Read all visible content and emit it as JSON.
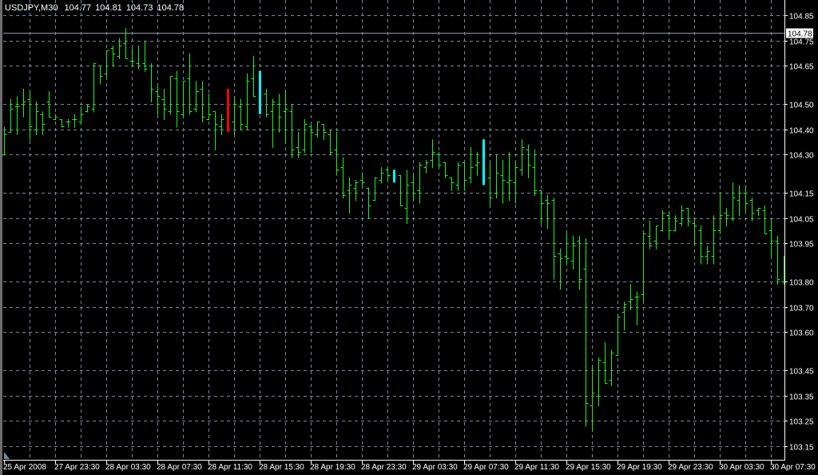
{
  "header": {
    "symbol": "USDJPY,M30",
    "open": "104.77",
    "high": "104.81",
    "low": "104.73",
    "close": "104.78"
  },
  "colors": {
    "background": "#000000",
    "bar": "#22ee22",
    "grid": "#778899",
    "axis": "#ffffff",
    "highlight_red": "#ff0000",
    "highlight_cyan": "#00ffff"
  },
  "chart_data": {
    "type": "ohlc",
    "title": "USDJPY,M30",
    "timeframe_minutes": 30,
    "ylim": [
      103.15,
      104.85
    ],
    "current_price": 104.78,
    "current_price_label": "104.78",
    "grid": true,
    "y_ticks": [
      "104.85",
      "104.75",
      "104.65",
      "104.50",
      "104.40",
      "104.30",
      "104.15",
      "104.05",
      "103.95",
      "103.80",
      "103.70",
      "103.60",
      "103.45",
      "103.35",
      "103.25",
      "103.15"
    ],
    "x_ticks": [
      {
        "bar": 0,
        "label": "25 Apr 2008"
      },
      {
        "bar": 8,
        "label": "27 Apr 23:30"
      },
      {
        "bar": 16,
        "label": "28 Apr 03:30"
      },
      {
        "bar": 24,
        "label": "28 Apr 07:30"
      },
      {
        "bar": 32,
        "label": "28 Apr 11:30"
      },
      {
        "bar": 40,
        "label": "28 Apr 15:30"
      },
      {
        "bar": 48,
        "label": "28 Apr 19:30"
      },
      {
        "bar": 56,
        "label": "28 Apr 23:30"
      },
      {
        "bar": 64,
        "label": "29 Apr 03:30"
      },
      {
        "bar": 72,
        "label": "29 Apr 07:30"
      },
      {
        "bar": 80,
        "label": "29 Apr 11:30"
      },
      {
        "bar": 88,
        "label": "29 Apr 15:30"
      },
      {
        "bar": 96,
        "label": "29 Apr 19:30"
      },
      {
        "bar": 104,
        "label": "29 Apr 23:30"
      },
      {
        "bar": 112,
        "label": "30 Apr 03:30"
      },
      {
        "bar": 120,
        "label": "30 Apr 07:30"
      }
    ],
    "highlights": [
      {
        "bar": 35,
        "color": "red"
      },
      {
        "bar": 40,
        "color": "cyan"
      },
      {
        "bar": 61,
        "color": "cyan"
      },
      {
        "bar": 75,
        "color": "cyan"
      }
    ],
    "ohlc": [
      [
        104.3,
        104.41,
        104.3,
        104.38
      ],
      [
        104.39,
        104.52,
        104.39,
        104.48
      ],
      [
        104.49,
        104.53,
        104.38,
        104.49
      ],
      [
        104.5,
        104.56,
        104.45,
        104.51
      ],
      [
        104.52,
        104.55,
        104.36,
        104.41
      ],
      [
        104.4,
        104.51,
        104.38,
        104.47
      ],
      [
        104.46,
        104.47,
        104.38,
        104.42
      ],
      [
        104.51,
        104.55,
        104.45,
        104.45
      ],
      [
        104.44,
        104.46,
        104.44,
        104.45
      ],
      [
        104.44,
        104.44,
        104.41,
        104.41
      ],
      [
        104.43,
        104.44,
        104.41,
        104.43
      ],
      [
        104.44,
        104.46,
        104.41,
        104.44
      ],
      [
        104.43,
        104.49,
        104.42,
        104.46
      ],
      [
        104.47,
        104.5,
        104.47,
        104.49
      ],
      [
        104.48,
        104.66,
        104.47,
        104.66
      ],
      [
        104.65,
        104.65,
        104.58,
        104.61
      ],
      [
        104.62,
        104.71,
        104.61,
        104.71
      ],
      [
        104.72,
        104.73,
        104.65,
        104.7
      ],
      [
        104.69,
        104.76,
        104.68,
        104.73
      ],
      [
        104.74,
        104.8,
        104.68,
        104.68
      ],
      [
        104.67,
        104.72,
        104.65,
        104.67
      ],
      [
        104.66,
        104.73,
        104.64,
        104.65
      ],
      [
        104.66,
        104.75,
        104.63,
        104.64
      ],
      [
        104.65,
        104.66,
        104.51,
        104.56
      ],
      [
        104.55,
        104.57,
        104.46,
        104.53
      ],
      [
        104.52,
        104.56,
        104.44,
        104.48
      ],
      [
        104.47,
        104.61,
        104.46,
        104.61
      ],
      [
        104.6,
        104.63,
        104.41,
        104.47
      ],
      [
        104.46,
        104.59,
        104.45,
        104.59
      ],
      [
        104.6,
        104.7,
        104.46,
        104.47
      ],
      [
        104.48,
        104.59,
        104.47,
        104.55
      ],
      [
        104.56,
        104.59,
        104.43,
        104.45
      ],
      [
        104.44,
        104.54,
        104.44,
        104.46
      ],
      [
        104.47,
        104.47,
        104.32,
        104.42
      ],
      [
        104.41,
        104.46,
        104.38,
        104.44
      ],
      [
        104.43,
        104.56,
        104.39,
        104.42
      ],
      [
        104.43,
        104.53,
        104.38,
        104.5
      ],
      [
        104.49,
        104.52,
        104.4,
        104.42
      ],
      [
        104.41,
        104.62,
        104.4,
        104.59
      ],
      [
        104.6,
        104.69,
        104.53,
        104.53
      ],
      [
        104.54,
        104.63,
        104.46,
        104.55
      ],
      [
        104.54,
        104.56,
        104.45,
        104.46
      ],
      [
        104.47,
        104.52,
        104.33,
        104.51
      ],
      [
        104.5,
        104.54,
        104.39,
        104.45
      ],
      [
        104.47,
        104.55,
        104.35,
        104.48
      ],
      [
        104.47,
        104.5,
        104.29,
        104.32
      ],
      [
        104.33,
        104.39,
        104.29,
        104.31
      ],
      [
        104.32,
        104.44,
        104.31,
        104.42
      ],
      [
        104.41,
        104.42,
        104.31,
        104.39
      ],
      [
        104.38,
        104.43,
        104.37,
        104.43
      ],
      [
        104.42,
        104.42,
        104.36,
        104.39
      ],
      [
        104.38,
        104.4,
        104.3,
        104.31
      ],
      [
        104.32,
        104.39,
        104.23,
        104.24
      ],
      [
        104.25,
        104.29,
        104.13,
        104.14
      ],
      [
        104.16,
        104.21,
        104.07,
        104.18
      ],
      [
        104.17,
        104.2,
        104.12,
        104.19
      ],
      [
        104.2,
        104.23,
        104.17,
        104.19
      ],
      [
        104.17,
        104.17,
        104.05,
        104.1
      ],
      [
        104.12,
        104.21,
        104.12,
        104.21
      ],
      [
        104.2,
        104.25,
        104.19,
        104.23
      ],
      [
        104.24,
        104.25,
        104.2,
        104.22
      ],
      [
        104.22,
        104.24,
        104.19,
        104.21
      ],
      [
        104.22,
        104.22,
        104.1,
        104.1
      ],
      [
        104.09,
        104.24,
        104.03,
        104.18
      ],
      [
        104.19,
        104.22,
        104.12,
        104.15
      ],
      [
        104.16,
        104.27,
        104.11,
        104.26
      ],
      [
        104.25,
        104.28,
        104.23,
        104.27
      ],
      [
        104.28,
        104.36,
        104.25,
        104.31
      ],
      [
        104.3,
        104.31,
        104.25,
        104.26
      ],
      [
        104.27,
        104.27,
        104.21,
        104.22
      ],
      [
        104.21,
        104.21,
        104.16,
        104.19
      ],
      [
        104.18,
        104.27,
        104.16,
        104.26
      ],
      [
        104.27,
        104.27,
        104.16,
        104.2
      ],
      [
        104.21,
        104.33,
        104.19,
        104.25
      ],
      [
        104.26,
        104.31,
        104.22,
        104.27
      ],
      [
        104.28,
        104.36,
        104.18,
        104.2
      ],
      [
        104.21,
        104.27,
        104.1,
        104.13
      ],
      [
        104.15,
        104.3,
        104.13,
        104.23
      ],
      [
        104.22,
        104.28,
        104.11,
        104.2
      ],
      [
        104.19,
        104.31,
        104.12,
        104.2
      ],
      [
        104.19,
        104.27,
        104.11,
        104.25
      ],
      [
        104.24,
        104.36,
        104.22,
        104.33
      ],
      [
        104.32,
        104.34,
        104.21,
        104.26
      ],
      [
        104.25,
        104.32,
        104.14,
        104.16
      ],
      [
        104.16,
        104.16,
        104.03,
        104.11
      ],
      [
        104.12,
        104.14,
        104.01,
        104.11
      ],
      [
        104.12,
        104.13,
        103.81,
        103.9
      ],
      [
        103.91,
        103.93,
        103.77,
        103.89
      ],
      [
        103.9,
        103.99,
        103.87,
        103.89
      ],
      [
        103.88,
        103.98,
        103.85,
        103.94
      ],
      [
        103.96,
        103.98,
        103.77,
        103.81
      ],
      [
        103.85,
        103.97,
        103.23,
        103.32
      ],
      [
        103.31,
        103.47,
        103.21,
        103.36
      ],
      [
        103.35,
        103.5,
        103.31,
        103.49
      ],
      [
        103.48,
        103.56,
        103.4,
        103.4
      ],
      [
        103.41,
        103.53,
        103.39,
        103.52
      ],
      [
        103.51,
        103.66,
        103.51,
        103.66
      ],
      [
        103.68,
        103.72,
        103.61,
        103.71
      ],
      [
        103.72,
        103.79,
        103.69,
        103.73
      ],
      [
        103.74,
        103.76,
        103.63,
        103.74
      ],
      [
        103.75,
        103.99,
        103.72,
        103.99
      ],
      [
        103.98,
        104.04,
        103.93,
        103.94
      ],
      [
        103.96,
        104.02,
        103.93,
        104.02
      ],
      [
        104.0,
        104.08,
        104.0,
        104.07
      ],
      [
        104.06,
        104.07,
        103.97,
        104.0
      ],
      [
        104.0,
        104.06,
        104.0,
        104.04
      ],
      [
        104.03,
        104.1,
        104.02,
        104.08
      ],
      [
        104.09,
        104.09,
        104.02,
        104.04
      ],
      [
        104.03,
        104.05,
        103.95,
        104.02
      ],
      [
        104.0,
        104.02,
        103.87,
        103.9
      ],
      [
        103.9,
        103.94,
        103.87,
        103.92
      ],
      [
        103.9,
        104.06,
        103.87,
        104.0
      ],
      [
        104.0,
        104.15,
        103.99,
        104.06
      ],
      [
        104.07,
        104.09,
        104.02,
        104.06
      ],
      [
        104.05,
        104.19,
        104.04,
        104.13
      ],
      [
        104.12,
        104.18,
        104.06,
        104.15
      ],
      [
        104.15,
        104.18,
        104.08,
        104.11
      ],
      [
        104.12,
        104.13,
        104.04,
        104.07
      ],
      [
        104.08,
        104.09,
        104.06,
        104.09
      ],
      [
        104.08,
        104.1,
        103.99,
        103.99
      ],
      [
        104.0,
        104.04,
        103.9,
        103.96
      ],
      [
        103.96,
        103.98,
        103.79,
        103.81
      ],
      [
        103.8,
        103.9,
        103.79,
        103.8
      ]
    ]
  }
}
